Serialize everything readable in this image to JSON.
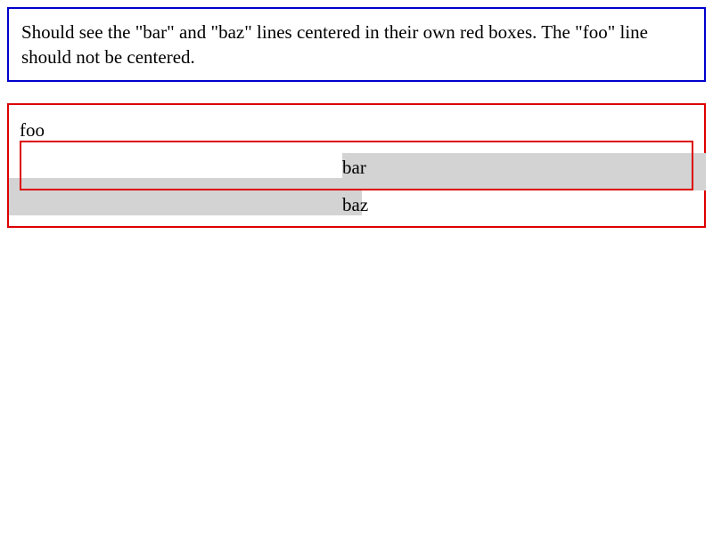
{
  "note": {
    "text": "Should see the \"bar\" and \"baz\" lines centered in their own red boxes. The \"foo\" line should not be centered."
  },
  "test": {
    "foo": "foo",
    "bar": "bar",
    "baz": "baz"
  },
  "colors": {
    "note_border": "#0000cc",
    "box_border": "#dd0000",
    "highlight": "#d3d3d3"
  }
}
